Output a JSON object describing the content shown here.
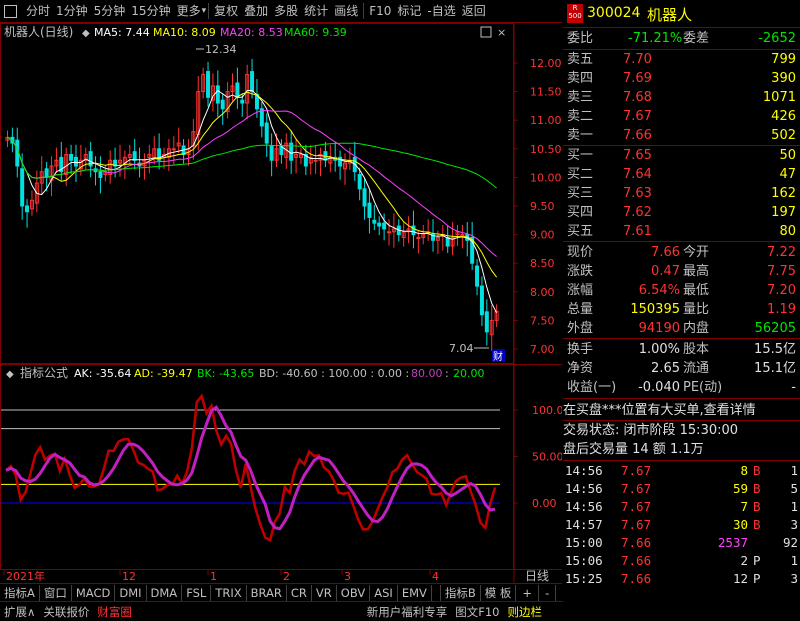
{
  "toolbar": {
    "items": [
      "分时",
      "1分钟",
      "5分钟",
      "15分钟",
      "更多",
      "复权",
      "叠加",
      "多股",
      "统计",
      "画线",
      "F10",
      "标记",
      "-自选",
      "返回"
    ]
  },
  "chart_header": {
    "name": "机器人(日线)",
    "ma5": "MA5: 7.44",
    "ma10": "MA10: 8.09",
    "ma20": "MA20: 8.53",
    "ma60": "MA60: 9.39",
    "high_label": "12.34",
    "low_label": "7.04",
    "cai_label": "财"
  },
  "price_axis": [
    "12.00",
    "11.50",
    "11.00",
    "10.50",
    "10.00",
    "9.50",
    "9.00",
    "8.50",
    "8.00",
    "7.50",
    "7.00"
  ],
  "indicator_header": {
    "title": "指标公式",
    "ak": "AK: -35.64",
    "ad": "AD: -39.47",
    "bk": "BK: -43.65",
    "bd": "BD: -40.60 : 100.00 : 0.00 :",
    "v80": "80.00",
    "sep": ":",
    "v20": "20.00"
  },
  "indicator_axis": [
    "100.0",
    "50.00",
    "0.00"
  ],
  "date_axis": [
    "2021年",
    "12",
    "1",
    "2",
    "3",
    "4"
  ],
  "period_label": "日线",
  "bottom_tabs": [
    "指标A",
    "窗口",
    "MACD",
    "DMI",
    "DMA",
    "FSL",
    "TRIX",
    "BRAR",
    "CR",
    "VR",
    "OBV",
    "ASI",
    "EMV",
    "指标B",
    "模 板",
    "+",
    "-"
  ],
  "status_bar": {
    "left": [
      "扩展∧",
      "关联报价",
      "财富圈"
    ],
    "mid": [
      "新用户福利专享",
      "图文F10",
      "则边栏"
    ],
    "right": [
      "笔",
      "价",
      "细",
      "势",
      "联",
      "值",
      "主",
      "筹"
    ]
  },
  "quote": {
    "badge_top": "R",
    "badge_bottom": "500",
    "code": "300024",
    "name": "机器人",
    "weibi_label": "委比",
    "weibi": "-71.21%",
    "weicha_label": "委差",
    "weicha": "-2652",
    "asks": [
      {
        "label": "卖五",
        "price": "7.70",
        "vol": "799"
      },
      {
        "label": "卖四",
        "price": "7.69",
        "vol": "390"
      },
      {
        "label": "卖三",
        "price": "7.68",
        "vol": "1071"
      },
      {
        "label": "卖二",
        "price": "7.67",
        "vol": "426"
      },
      {
        "label": "卖一",
        "price": "7.66",
        "vol": "502"
      }
    ],
    "bids": [
      {
        "label": "买一",
        "price": "7.65",
        "vol": "50"
      },
      {
        "label": "买二",
        "price": "7.64",
        "vol": "47"
      },
      {
        "label": "买三",
        "price": "7.63",
        "vol": "162"
      },
      {
        "label": "买四",
        "price": "7.62",
        "vol": "197"
      },
      {
        "label": "买五",
        "price": "7.61",
        "vol": "80"
      }
    ],
    "stats": [
      {
        "l1": "现价",
        "v1": "7.66",
        "l2": "今开",
        "v2": "7.22"
      },
      {
        "l1": "涨跌",
        "v1": "0.47",
        "l2": "最高",
        "v2": "7.75"
      },
      {
        "l1": "涨幅",
        "v1": "6.54%",
        "l2": "最低",
        "v2": "7.20"
      },
      {
        "l1": "总量",
        "v1": "150395",
        "l2": "量比",
        "v2": "1.19"
      },
      {
        "l1": "外盘",
        "v1": "94190",
        "l2": "内盘",
        "v2": "56205"
      }
    ],
    "stats2": [
      {
        "l1": "换手",
        "v1": "1.00%",
        "l2": "股本",
        "v2": "15.5亿"
      },
      {
        "l1": "净资",
        "v1": "2.65",
        "l2": "流通",
        "v2": "15.1亿"
      },
      {
        "l1": "收益(一)",
        "v1": "-0.040",
        "l2": "PE(动)",
        "v2": "-"
      }
    ],
    "notice": "在买盘***位置有大买单,查看详情",
    "trade_state": "交易状态: 闭市阶段 15:30:00",
    "after_hours": "盘后交易量 14 额 1.1万",
    "ticks": [
      {
        "t": "14:56",
        "p": "7.67",
        "v": "8",
        "f": "B",
        "n": "1"
      },
      {
        "t": "14:56",
        "p": "7.67",
        "v": "59",
        "f": "B",
        "n": "5"
      },
      {
        "t": "14:56",
        "p": "7.67",
        "v": "7",
        "f": "B",
        "n": "1"
      },
      {
        "t": "14:57",
        "p": "7.67",
        "v": "30",
        "f": "B",
        "n": "3"
      },
      {
        "t": "15:00",
        "p": "7.66",
        "v": "2537",
        "f": "",
        "n": "92"
      },
      {
        "t": "15:06",
        "p": "7.66",
        "v": "2",
        "f": "P",
        "n": "1"
      },
      {
        "t": "15:25",
        "p": "7.66",
        "v": "12",
        "f": "P",
        "n": "3"
      }
    ]
  },
  "colors": {
    "up": "#ff3232",
    "down": "#00e0e0",
    "border": "#800000",
    "ma5": "#ffffff",
    "ma10": "#ffff00",
    "ma20": "#ff40ff",
    "ma60": "#00e600"
  }
}
